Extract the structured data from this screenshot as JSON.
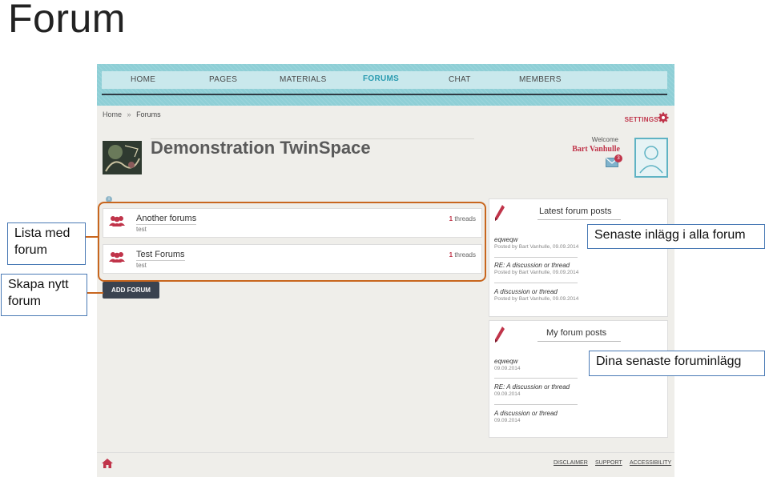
{
  "slide": {
    "title": "Forum"
  },
  "nav": {
    "items": [
      {
        "label": "HOME",
        "active": false
      },
      {
        "label": "PAGES",
        "active": false
      },
      {
        "label": "MATERIALS",
        "active": false
      },
      {
        "label": "FORUMS",
        "active": true
      },
      {
        "label": "CHAT",
        "active": false
      },
      {
        "label": "MEMBERS",
        "active": false
      }
    ]
  },
  "breadcrumb": {
    "home": "Home",
    "separator": "»",
    "current": "Forums"
  },
  "header": {
    "settings_label": "SETTINGS",
    "space_title": "Demonstration TwinSpace",
    "welcome": "Welcome",
    "user_name": "Bart Vanhulle",
    "mail_count": "3"
  },
  "forums": [
    {
      "name": "Another forums",
      "description": "test",
      "count": "1",
      "count_label": "threads"
    },
    {
      "name": "Test Forums",
      "description": "test",
      "count": "1",
      "count_label": "threads"
    }
  ],
  "add_forum_label": "ADD FORUM",
  "latest_posts": {
    "title": "Latest forum posts",
    "posts": [
      {
        "title": "eqweqw",
        "meta": "Posted by Bart Vanhulle, 09.09.2014"
      },
      {
        "title": "RE: A discussion or thread",
        "meta": "Posted by Bart Vanhulle, 09.09.2014"
      },
      {
        "title": "A discussion or thread",
        "meta": "Posted by Bart Vanhulle, 09.09.2014"
      }
    ]
  },
  "my_posts": {
    "title": "My forum posts",
    "posts": [
      {
        "title": "eqweqw",
        "meta": "09.09.2014"
      },
      {
        "title": "RE: A discussion or thread",
        "meta": "09.09.2014"
      },
      {
        "title": "A discussion or thread",
        "meta": "09.09.2014"
      }
    ]
  },
  "footer": {
    "links": [
      "DISCLAIMER",
      "SUPPORT",
      "ACCESSIBILITY"
    ]
  },
  "annotations": {
    "lista": "Lista med forum",
    "skapa": "Skapa nytt forum",
    "senaste": "Senaste inlägg i alla forum",
    "dina": "Dina senaste foruminlägg"
  },
  "colors": {
    "accent": "#c0344a",
    "nav_bg": "#8ecfd6",
    "annotation_line": "#c8661e"
  },
  "icons": [
    "settings-gear-icon",
    "mail-icon",
    "avatar-icon",
    "forum-group-icon",
    "pencil-icon",
    "home-icon",
    "info-icon"
  ]
}
